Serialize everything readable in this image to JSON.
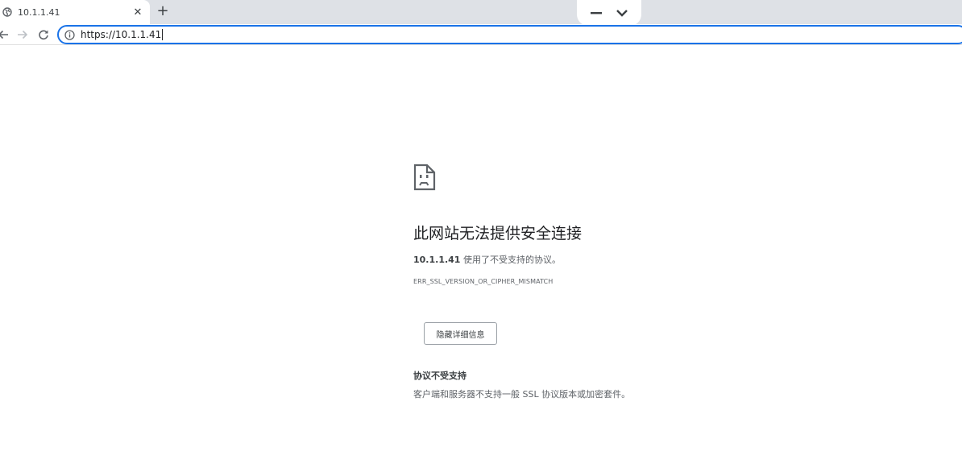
{
  "tab": {
    "title": "10.1.1.41",
    "favicon": "globe-icon",
    "close_glyph": "✕"
  },
  "new_tab_glyph": "+",
  "toolbar": {
    "back_icon": "back-arrow-icon",
    "forward_icon": "forward-arrow-icon",
    "reload_icon": "reload-icon",
    "address": "https://10.1.1.41",
    "site_info_icon": "info-icon"
  },
  "error": {
    "icon": "sad-document-icon",
    "title": "此网站无法提供安全连接",
    "host": "10.1.1.41",
    "description": " 使用了不受支持的协议。",
    "code": "ERR_SSL_VERSION_OR_CIPHER_MISMATCH",
    "details_button": "隐藏详细信息",
    "details_heading": "协议不受支持",
    "details_text": "客户端和服务器不支持一般 SSL 协议版本或加密套件。"
  },
  "colors": {
    "accent": "#1a73e8",
    "tabstrip": "#dee1e6",
    "text": "#202124",
    "secondary_text": "#5f6368"
  }
}
